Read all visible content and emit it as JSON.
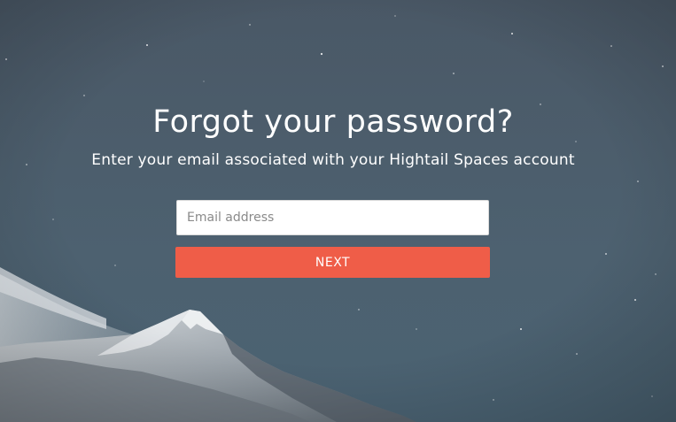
{
  "page": {
    "title": "Forgot your password?",
    "subtitle": "Enter your email associated with your Hightail Spaces account"
  },
  "form": {
    "email_placeholder": "Email address",
    "email_value": "",
    "submit_label": "NEXT"
  },
  "colors": {
    "sky": "#4b5e6c",
    "button": "#ef5d48",
    "text": "#ffffff"
  },
  "background": {
    "description_icon": "mountain-night-sky-background"
  }
}
